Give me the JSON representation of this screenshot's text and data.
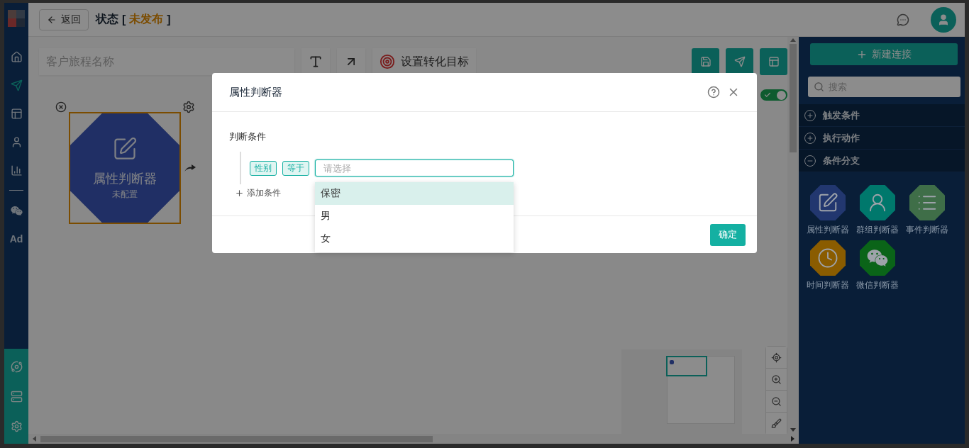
{
  "sidebar": {
    "items": [
      {
        "kind": "icon",
        "selected": false
      },
      {
        "kind": "icon",
        "selected": true
      },
      {
        "kind": "icon",
        "selected": false
      },
      {
        "kind": "icon",
        "selected": false
      },
      {
        "kind": "icon",
        "selected": false
      },
      {
        "kind": "icon",
        "selected": false
      },
      {
        "kind": "text",
        "label": "Ad",
        "selected": false
      }
    ],
    "bottom_items": [
      {
        "selected": false
      },
      {
        "selected": false
      },
      {
        "selected": false
      }
    ]
  },
  "header": {
    "back_button": "返回",
    "title": "状态",
    "status": {
      "open": "[",
      "label": "未发布",
      "close": "]"
    }
  },
  "toolbar": {
    "name_placeholder": "客户旅程名称",
    "goal_button": "设置转化目标",
    "auto_toggle": {
      "on": true
    }
  },
  "canvas": {
    "node": {
      "title": "属性判断器",
      "subtitle": "未配置",
      "selected": true
    }
  },
  "right_panel": {
    "new_button": "新建连接",
    "search_placeholder": "搜索",
    "sections": [
      {
        "title": "触发条件",
        "expanded": false
      },
      {
        "title": "执行动作",
        "expanded": false
      },
      {
        "title": "条件分支",
        "expanded": true,
        "items": [
          {
            "label": "属性判断器",
            "color": "#22376f"
          },
          {
            "label": "群组判断器",
            "color": "#00786c"
          },
          {
            "label": "事件判断器",
            "color": "#3f6e48"
          },
          {
            "label": "时间判断器",
            "color": "#8a5c00"
          },
          {
            "label": "微信判断器",
            "color": "#0a6418"
          }
        ]
      }
    ]
  },
  "dialog": {
    "title": "属性判断器",
    "section_label": "判断条件",
    "condition": {
      "tags": [
        "性别",
        "等于"
      ],
      "placeholder": "请选择",
      "options": [
        {
          "label": "保密",
          "selected": true
        },
        {
          "label": "男",
          "selected": false
        },
        {
          "label": "女",
          "selected": false
        }
      ]
    },
    "add_condition": "添加条件",
    "confirm_button": "确定"
  }
}
